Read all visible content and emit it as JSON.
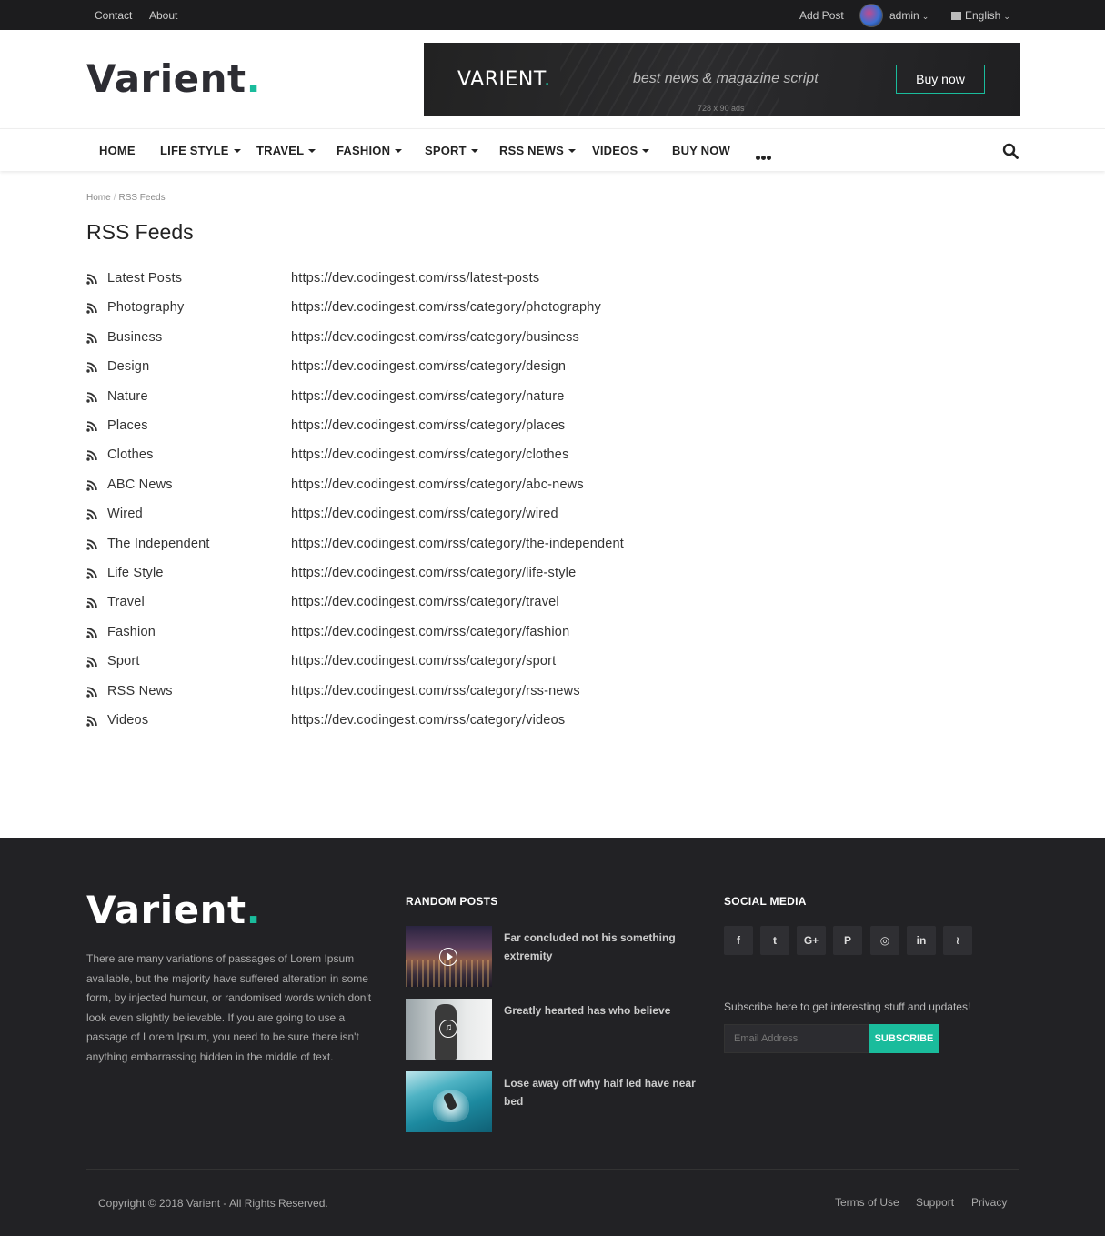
{
  "topbar": {
    "contact": "Contact",
    "about": "About",
    "add_post": "Add Post",
    "user": "admin",
    "language": "English"
  },
  "brand": {
    "name": "Varient",
    "dot": ".",
    "accent_color": "#1abc9c"
  },
  "ad": {
    "logo": "VARIENT",
    "tagline": "best news & magazine script",
    "button": "Buy now",
    "size_label": "728 x 90 ads"
  },
  "nav": {
    "items": [
      {
        "label": "HOME",
        "dropdown": false
      },
      {
        "label": "LIFE STYLE",
        "dropdown": true
      },
      {
        "label": "TRAVEL",
        "dropdown": true
      },
      {
        "label": "FASHION",
        "dropdown": true
      },
      {
        "label": "SPORT",
        "dropdown": true
      },
      {
        "label": "RSS NEWS",
        "dropdown": true
      },
      {
        "label": "VIDEOS",
        "dropdown": true
      },
      {
        "label": "BUY NOW",
        "dropdown": false
      }
    ],
    "more_icon": "ellipsis-icon",
    "search_icon": "search-icon"
  },
  "breadcrumb": {
    "home": "Home",
    "separator": "/",
    "current": "RSS Feeds"
  },
  "page": {
    "title": "RSS Feeds"
  },
  "feeds": [
    {
      "name": "Latest Posts",
      "url": "https://dev.codingest.com/rss/latest-posts"
    },
    {
      "name": "Photography",
      "url": "https://dev.codingest.com/rss/category/photography"
    },
    {
      "name": "Business",
      "url": "https://dev.codingest.com/rss/category/business"
    },
    {
      "name": "Design",
      "url": "https://dev.codingest.com/rss/category/design"
    },
    {
      "name": "Nature",
      "url": "https://dev.codingest.com/rss/category/nature"
    },
    {
      "name": "Places",
      "url": "https://dev.codingest.com/rss/category/places"
    },
    {
      "name": "Clothes",
      "url": "https://dev.codingest.com/rss/category/clothes"
    },
    {
      "name": "ABC News",
      "url": "https://dev.codingest.com/rss/category/abc-news"
    },
    {
      "name": "Wired",
      "url": "https://dev.codingest.com/rss/category/wired"
    },
    {
      "name": "The Independent",
      "url": "https://dev.codingest.com/rss/category/the-independent"
    },
    {
      "name": "Life Style",
      "url": "https://dev.codingest.com/rss/category/life-style"
    },
    {
      "name": "Travel",
      "url": "https://dev.codingest.com/rss/category/travel"
    },
    {
      "name": "Fashion",
      "url": "https://dev.codingest.com/rss/category/fashion"
    },
    {
      "name": "Sport",
      "url": "https://dev.codingest.com/rss/category/sport"
    },
    {
      "name": "RSS News",
      "url": "https://dev.codingest.com/rss/category/rss-news"
    },
    {
      "name": "Videos",
      "url": "https://dev.codingest.com/rss/category/videos"
    }
  ],
  "footer": {
    "about_text": "There are many variations of passages of Lorem Ipsum available, but the majority have suffered alteration in some form, by injected humour, or randomised words which don't look even slightly believable. If you are going to use a passage of Lorem Ipsum, you need to be sure there isn't anything embarrassing hidden in the middle of text.",
    "random_posts_heading": "RANDOM POSTS",
    "random_posts": [
      {
        "title": "Far concluded not his something extremity",
        "media": "video"
      },
      {
        "title": "Greatly hearted has who believe",
        "media": "audio"
      },
      {
        "title": "Lose away off why half led have near bed",
        "media": "image"
      }
    ],
    "social_heading": "SOCIAL MEDIA",
    "social": [
      {
        "icon": "facebook-icon",
        "glyph": "f"
      },
      {
        "icon": "twitter-icon",
        "glyph": "t"
      },
      {
        "icon": "google-plus-icon",
        "glyph": "G+"
      },
      {
        "icon": "pinterest-icon",
        "glyph": "P"
      },
      {
        "icon": "instagram-icon",
        "glyph": "◎"
      },
      {
        "icon": "linkedin-icon",
        "glyph": "in"
      },
      {
        "icon": "rss-icon",
        "glyph": "≀"
      }
    ],
    "subscribe_text": "Subscribe here to get interesting stuff and updates!",
    "email_placeholder": "Email Address",
    "subscribe_button": "SUBSCRIBE",
    "copyright": "Copyright © 2018 Varient - All Rights Reserved.",
    "links": [
      "Terms of Use",
      "Support",
      "Privacy"
    ]
  }
}
